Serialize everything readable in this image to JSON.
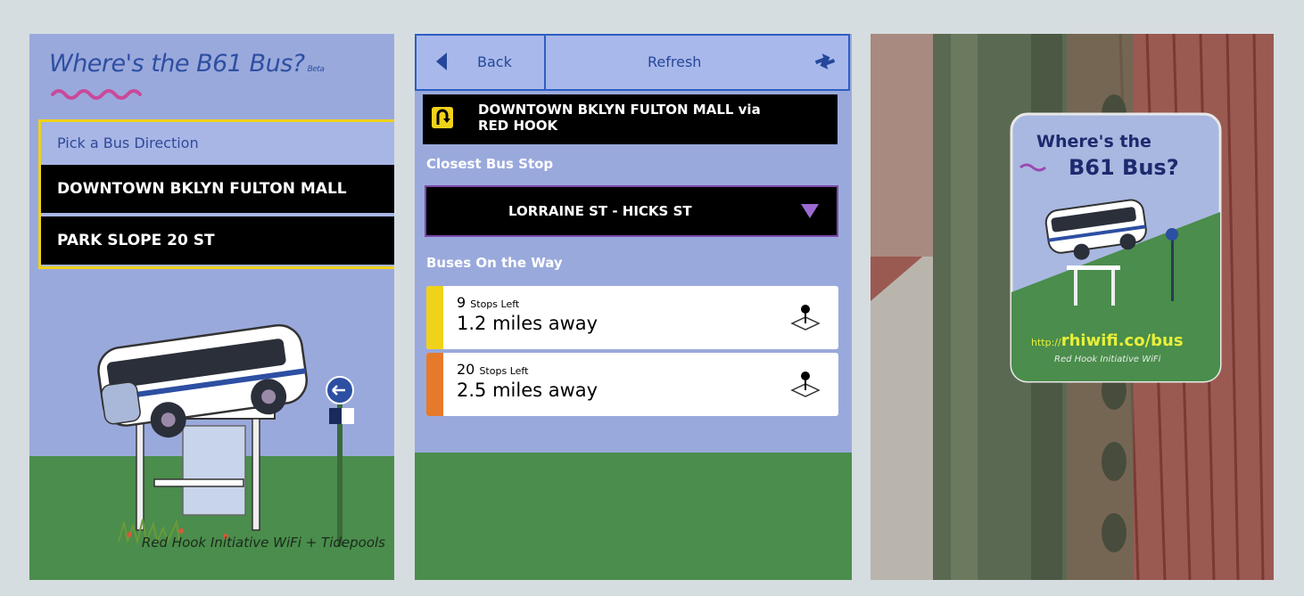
{
  "panel1": {
    "title": "Where's the B61 Bus?",
    "beta": "Beta",
    "menu_header": "Pick a Bus Direction",
    "directions": [
      "DOWNTOWN BKLYN FULTON MALL",
      "PARK SLOPE 20 ST"
    ],
    "footer": "Red Hook Initiative WiFi + Tidepools"
  },
  "panel2": {
    "back_label": "Back",
    "refresh_label": "Refresh",
    "route_line1": "DOWNTOWN BKLYN FULTON MALL via",
    "route_line2": "RED HOOK",
    "closest_label": "Closest Bus Stop",
    "stop_name": "LORRAINE ST - HICKS ST",
    "buses_label": "Buses On the Way",
    "buses": [
      {
        "stops": "9",
        "stops_suffix": "Stops Left",
        "distance": "1.2 miles away",
        "color": "#f0d21a"
      },
      {
        "stops": "20",
        "stops_suffix": "Stops Left",
        "distance": "2.5 miles away",
        "color": "#e57a2a"
      }
    ]
  },
  "panel3": {
    "sticker_line1": "Where's the",
    "sticker_line2": "B61 Bus?",
    "sticker_url_prefix": "http://",
    "sticker_url": "rhiwifi.co/bus",
    "sticker_footer": "Red Hook Initiative WiFi"
  },
  "colors": {
    "sky": "#9aa9dc",
    "grass": "#4a8d4c",
    "accent_blue": "#2d4fa2",
    "highlight_yellow": "#f0d21a",
    "highlight_orange": "#e57a2a"
  }
}
